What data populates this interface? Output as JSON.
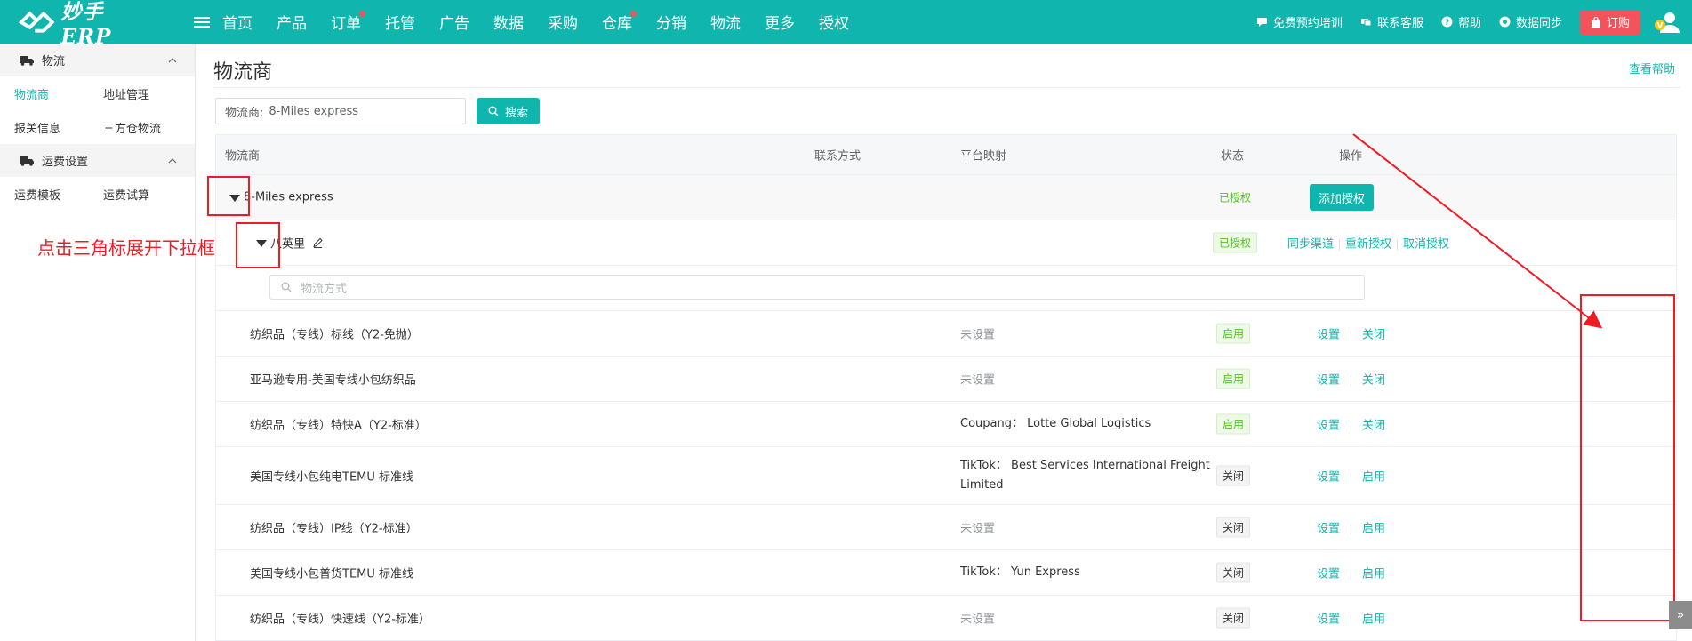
{
  "app": {
    "logo_text": "妙手ERP",
    "nav": [
      {
        "label": "首页",
        "dot": false
      },
      {
        "label": "产品",
        "dot": false
      },
      {
        "label": "订单",
        "dot": true
      },
      {
        "label": "托管",
        "dot": false
      },
      {
        "label": "广告",
        "dot": false
      },
      {
        "label": "数据",
        "dot": false
      },
      {
        "label": "采购",
        "dot": false
      },
      {
        "label": "仓库",
        "dot": true
      },
      {
        "label": "分销",
        "dot": false
      },
      {
        "label": "物流",
        "dot": false
      },
      {
        "label": "更多",
        "dot": false
      },
      {
        "label": "授权",
        "dot": false
      }
    ],
    "top_links": [
      {
        "label": "免费预约培训",
        "icon": "chat-icon"
      },
      {
        "label": "联系客服",
        "icon": "service-icon"
      },
      {
        "label": "帮助",
        "icon": "help-icon"
      },
      {
        "label": "数据同步",
        "icon": "sync-icon"
      }
    ],
    "order_button": "订购",
    "brand_color": "#10b5ad",
    "accent_red": "#f2545b"
  },
  "sidebar": {
    "groups": [
      {
        "title": "物流",
        "rows": [
          [
            {
              "label": "物流商",
              "active": true
            },
            {
              "label": "地址管理",
              "active": false
            }
          ],
          [
            {
              "label": "报关信息",
              "active": false
            },
            {
              "label": "三方仓物流",
              "active": false
            }
          ]
        ]
      },
      {
        "title": "运费设置",
        "rows": [
          [
            {
              "label": "运费模板",
              "active": false
            },
            {
              "label": "运费试算",
              "active": false
            }
          ]
        ]
      }
    ]
  },
  "page": {
    "title": "物流商",
    "help_link": "查看帮助",
    "filter_label": "物流商:",
    "filter_value": "8-Miles express",
    "search_button": "搜索",
    "columns": [
      "物流商",
      "联系方式",
      "平台映射",
      "状态",
      "操作"
    ],
    "provider": {
      "name": "8-Miles express",
      "status": "已授权",
      "action": "添加授权"
    },
    "account": {
      "name": "八英里",
      "status": "已授权",
      "actions": [
        "同步渠道",
        "重新授权",
        "取消授权"
      ]
    },
    "method_placeholder": "物流方式",
    "methods": [
      {
        "name": "纺织品（专线）标线（Y2-免抛）",
        "platform": "未设置",
        "platform_set": false,
        "status": "启用",
        "enabled": true,
        "set": "设置",
        "toggle": "关闭"
      },
      {
        "name": "亚马逊专用-美国专线小包纺织品",
        "platform": "未设置",
        "platform_set": false,
        "status": "启用",
        "enabled": true,
        "set": "设置",
        "toggle": "关闭"
      },
      {
        "name": "纺织品（专线）特快A（Y2-标准）",
        "platform": "Coupang：  Lotte Global Logistics",
        "platform_set": true,
        "status": "启用",
        "enabled": true,
        "set": "设置",
        "toggle": "关闭"
      },
      {
        "name": "美国专线小包纯电TEMU 标准线",
        "platform": "TikTok：  Best Services International Freight Limited",
        "platform_set": true,
        "status": "关闭",
        "enabled": false,
        "set": "设置",
        "toggle": "启用"
      },
      {
        "name": "纺织品（专线）IP线（Y2-标准）",
        "platform": "未设置",
        "platform_set": false,
        "status": "关闭",
        "enabled": false,
        "set": "设置",
        "toggle": "启用"
      },
      {
        "name": "美国专线小包普货TEMU 标准线",
        "platform": "TikTok：  Yun Express",
        "platform_set": true,
        "status": "关闭",
        "enabled": false,
        "set": "设置",
        "toggle": "启用"
      },
      {
        "name": "纺织品（专线）快速线（Y2-标准）",
        "platform": "未设置",
        "platform_set": false,
        "status": "关闭",
        "enabled": false,
        "set": "设置",
        "toggle": "启用"
      }
    ]
  },
  "annotation": {
    "text": "点击三角标展开下拉框",
    "color": "#ee1c25"
  }
}
